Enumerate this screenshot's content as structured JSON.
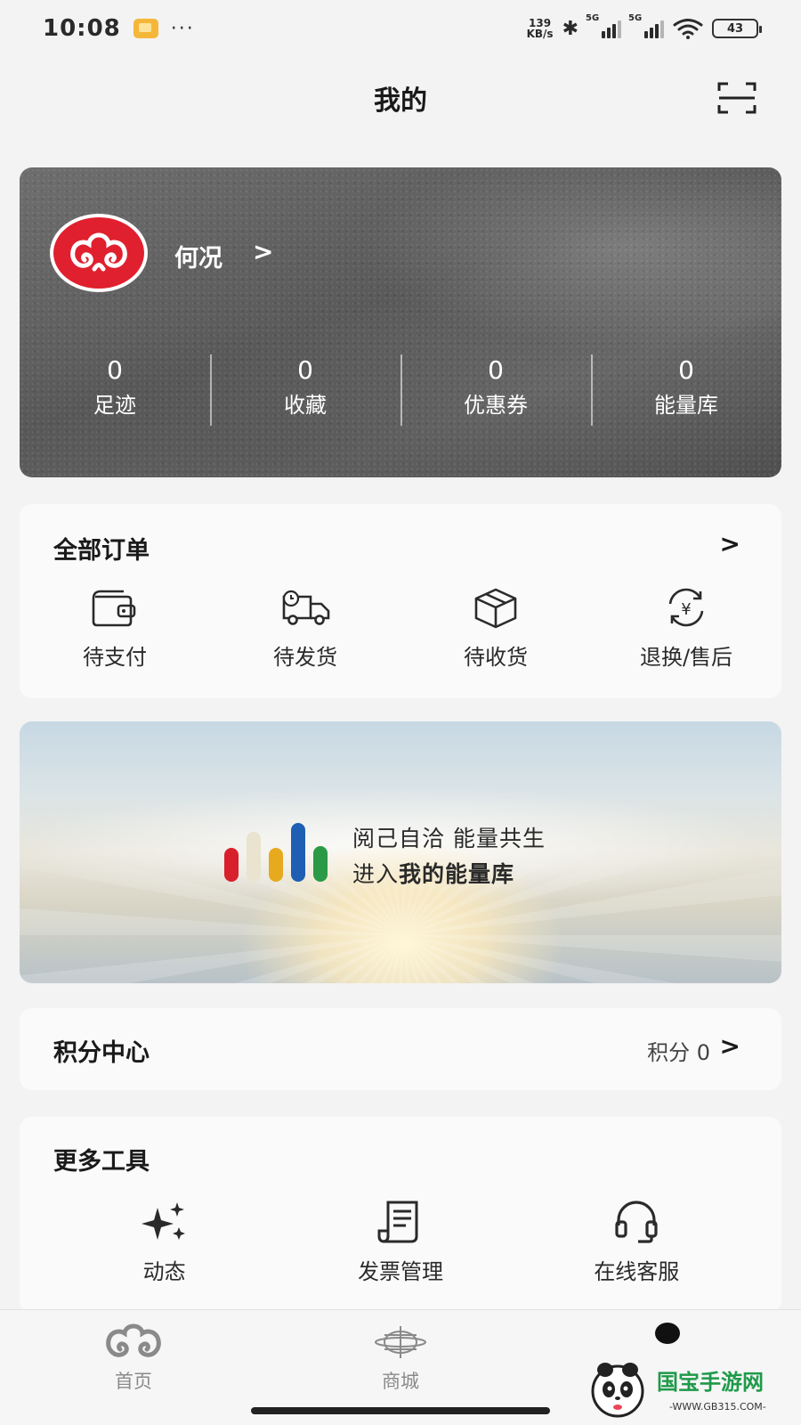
{
  "status_bar": {
    "time": "10:08",
    "dots": "···",
    "net_speed_value": "139",
    "net_speed_unit": "KB/s",
    "signal_label_1": "5G",
    "signal_label_2": "5G",
    "battery": "43"
  },
  "header": {
    "title": "我的",
    "scan_icon": "scan-icon"
  },
  "profile": {
    "username": "何况",
    "arrow": ">",
    "stats": [
      {
        "value": "0",
        "label": "足迹"
      },
      {
        "value": "0",
        "label": "收藏"
      },
      {
        "value": "0",
        "label": "优惠券"
      },
      {
        "value": "0",
        "label": "能量库"
      }
    ]
  },
  "orders": {
    "title": "全部订单",
    "chevron": ">",
    "items": [
      {
        "label": "待支付",
        "icon": "wallet-icon"
      },
      {
        "label": "待发货",
        "icon": "delivery-truck-icon"
      },
      {
        "label": "待收货",
        "icon": "package-box-icon"
      },
      {
        "label": "退换/售后",
        "icon": "yen-refund-icon"
      }
    ]
  },
  "banner": {
    "line1": "阅己自洽  能量共生",
    "line2_prefix": "进入",
    "line2_bold": "我的能量库",
    "bar_colors": [
      "#d8202c",
      "#e9e3cf",
      "#e7a91e",
      "#1f5fb3",
      "#2a9a46"
    ]
  },
  "points": {
    "title": "积分中心",
    "value_label": "积分 0",
    "chevron": ">"
  },
  "tools": {
    "title": "更多工具",
    "items": [
      {
        "label": "动态",
        "icon": "sparkles-icon"
      },
      {
        "label": "发票管理",
        "icon": "invoice-icon"
      },
      {
        "label": "在线客服",
        "icon": "headset-icon"
      }
    ]
  },
  "tabbar": {
    "tabs": [
      {
        "label": "首页",
        "icon": "home-logo-icon"
      },
      {
        "label": "商城",
        "icon": "mall-icon"
      }
    ]
  },
  "watermark": {
    "brand": "国宝手游网",
    "url": "-WWW.GB315.COM-"
  },
  "colors": {
    "brand_red": "#e0202e",
    "background": "#f3f3f4",
    "card": "#fafafa"
  }
}
